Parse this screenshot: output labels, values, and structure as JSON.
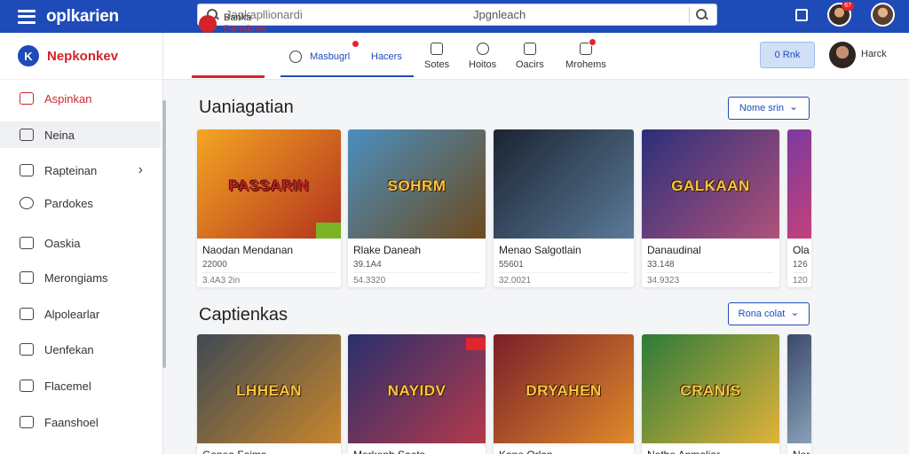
{
  "app": {
    "title": "oplkarien"
  },
  "search": {
    "placeholder": "Japkapllionardi",
    "center_text": "Jpgnleach"
  },
  "topbar": {
    "notification_count": "67"
  },
  "sidebar": {
    "brand": "Nepkonkev",
    "items": [
      {
        "label": "Aspinkan",
        "icon": "controller-icon",
        "active": false,
        "highlight": true
      },
      {
        "label": "Neina",
        "icon": "grid-icon",
        "active": true
      },
      {
        "label": "Rapteinan",
        "icon": "folder-icon",
        "active": false,
        "chevron": "›"
      },
      {
        "label": "Pardokes",
        "icon": "clock-icon",
        "active": false
      },
      {
        "label": "Oaskia",
        "icon": "image-icon",
        "active": false
      },
      {
        "label": "Merongiams",
        "icon": "list-icon",
        "active": false
      },
      {
        "label": "Alpolearlar",
        "icon": "tag-icon",
        "active": false
      },
      {
        "label": "Uenfekan",
        "icon": "square-icon",
        "active": false
      },
      {
        "label": "Flacemel",
        "icon": "trophy-icon",
        "active": false
      },
      {
        "label": "Faanshoel",
        "icon": "gear-icon",
        "active": false
      }
    ]
  },
  "tabs": {
    "first": {
      "line1": "Banka",
      "line2": "Danabres"
    },
    "second": {
      "label": "Masbugrl"
    },
    "third": {
      "label": "Hacers"
    },
    "items": [
      {
        "label": "Sotes",
        "icon": "pencil-icon"
      },
      {
        "label": "Hoitos",
        "icon": "disc-icon"
      },
      {
        "label": "Oacirs",
        "icon": "briefcase-icon"
      },
      {
        "label": "Mrohems",
        "icon": "inbox-icon"
      }
    ],
    "rank_button": "0 Rnk",
    "user_name": "Harck"
  },
  "sections": [
    {
      "title": "Uaniagatian",
      "filter": "Nome srin",
      "cards": [
        {
          "name": "Naodan Mendanan",
          "meta1": "22000",
          "meta2": "3.4A3 2in",
          "art": "PASSARIN",
          "colors": [
            "#f4a623",
            "#b2321e"
          ]
        },
        {
          "name": "Rlake Daneah",
          "meta1": "39.1A4",
          "meta2": "54.3320",
          "art": "SOHRM",
          "colors": [
            "#4a8fbf",
            "#6d4a1e"
          ]
        },
        {
          "name": "Menao Salgotlain",
          "meta1": "55601",
          "meta2": "32.0021",
          "art": "",
          "colors": [
            "#1b2432",
            "#5b7a98"
          ]
        },
        {
          "name": "Danaudinal",
          "meta1": "33.148",
          "meta2": "34.9323",
          "art": "GALKAAN",
          "colors": [
            "#2b2f7a",
            "#b0527a"
          ]
        },
        {
          "name": "Ola",
          "meta1": "126",
          "meta2": "120",
          "art": "",
          "colors": [
            "#7b3aa0",
            "#c3417a"
          ]
        }
      ]
    },
    {
      "title": "Captienkas",
      "filter": "Rona colat",
      "cards": [
        {
          "name": "Ganea Faims",
          "art": "LHHEAN",
          "colors": [
            "#3e4a52",
            "#c9852e"
          ]
        },
        {
          "name": "Merkenh Saets",
          "art": "NAYIDV",
          "colors": [
            "#2a2f6e",
            "#b33a4a"
          ]
        },
        {
          "name": "Kane Orlan",
          "art": "DRYAHEN",
          "colors": [
            "#7a1f2a",
            "#e08a2a"
          ]
        },
        {
          "name": "Nethe Anmaliar",
          "art": "CRANIS",
          "colors": [
            "#2d7a3a",
            "#e0b33a"
          ]
        },
        {
          "name": "Nor",
          "art": "",
          "colors": [
            "#3a4a6a",
            "#8aa0b8"
          ]
        }
      ]
    }
  ],
  "icons": {
    "menu": "hamburger-icon",
    "search": "search-icon",
    "bag": "bag-icon",
    "chevron": "chevron-down-icon"
  },
  "chevron_down": "⌄",
  "accent_colors": {
    "primary": "#1f4bb8",
    "danger": "#d4232b"
  }
}
